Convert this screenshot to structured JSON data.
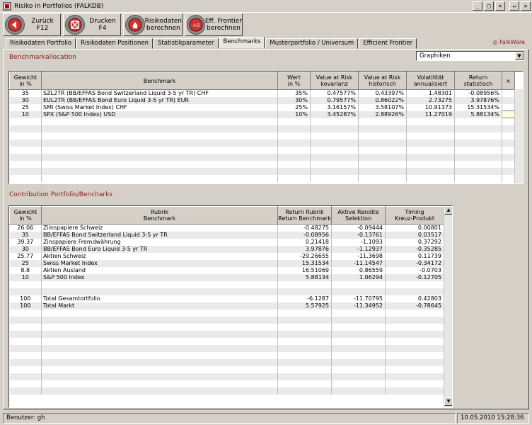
{
  "window": {
    "title": "Risiko in Portfolios   (FALKDB)",
    "controls": [
      "_",
      "□",
      "×",
      "↵",
      "✕"
    ]
  },
  "toolbar": [
    {
      "label": "Zurück\nF12",
      "icon": "back-arrow-icon"
    },
    {
      "label": "Drucken\nF4",
      "icon": "print-cancel-icon"
    },
    {
      "label": "Risikodaten\nberechnen",
      "icon": "calculate-risk-icon"
    },
    {
      "label": "Eff. Frontier\nberechnen",
      "icon": "frontier-calc-icon"
    }
  ],
  "tabs": [
    "Risikodaten Portfolio",
    "Risikodaten Positionen",
    "Statistikparameter",
    "Benchmarks",
    "Musterportfolio / Universum",
    "Efficient Frontier"
  ],
  "active_tab": "Benchmarks",
  "brand": "◎ FalkWare",
  "section1": {
    "title": "Benchmarkallocation",
    "dropdown_value": "Graphiken"
  },
  "table1": {
    "headers": [
      "Gewicht\nin %",
      "Benchmark",
      "Wert\nin %",
      "Value at Risk\nkovarianz",
      "Value at Risk\nhistorisch",
      "Volatilität\nannualisiert",
      "Return\nstatistisch",
      "×"
    ],
    "rows": [
      [
        "35",
        "SZL2TR  (BB/EFFAS Bond Switzerland Liquid 3-5 yr TR)  CHF",
        "35%",
        "0.47577%",
        "0.43397%",
        "1.48301",
        "-0.08956%"
      ],
      [
        "30",
        "EUL2TR  (BB/EFFAS Bond Euro Liquid 3-5 yr TR)  EUR",
        "30%",
        "0.79577%",
        "0.86022%",
        "2.73275",
        "3.97876%"
      ],
      [
        "25",
        "SMI  (Swiss Market Index)  CHF",
        "25%",
        "3.16157%",
        "3.58107%",
        "10.91373",
        "15.31534%"
      ],
      [
        "10",
        "SPX  (S&P 500 Index)  USD",
        "10%",
        "3.45287%",
        "2.88926%",
        "11.27019",
        "5.88134%"
      ]
    ]
  },
  "section2": {
    "title": "Contribution Portfolio/Bencharks"
  },
  "table2": {
    "headers": [
      "Gewicht\nin %",
      "Rubrik\nBenchmark",
      "Return Rubrik\nReturn Benchmark",
      "Aktive Rendite\nSelektion",
      "Timing\nKreuz-Produkt"
    ],
    "rows": [
      [
        "26.06",
        "Ziinspapiere Schweiz",
        "-0.48275",
        "-0.09444",
        "0.00801"
      ],
      [
        "35",
        "BB/EFFAS Bond Switzerland Liquid 3-5 yr TR",
        "-0.08956",
        "-0.13761",
        "0.03517"
      ],
      [
        "39.37",
        "Zinspapiere Fremdwährung",
        "0.21418",
        "-1.1093",
        "0.37292"
      ],
      [
        "30",
        "BB/EFFAS Bond Euro Liquid 3-5 yr TR",
        "3.97876",
        "-1.12937",
        "-0.35285"
      ],
      [
        "25.77",
        "Aktien Schweiz",
        "-29.26655",
        "-11.3698",
        "0.11739"
      ],
      [
        "25",
        "Swiss Market Index",
        "15.31534",
        "-11.14547",
        "-0.34172"
      ],
      [
        "8.8",
        "Aktien Ausland",
        "16.51069",
        "0.86559",
        "-0.0703"
      ],
      [
        "10",
        "S&P 500 Index",
        "5.88134",
        "1.06294",
        "-0.12705"
      ],
      [
        "",
        "",
        "",
        "",
        ""
      ],
      [
        "",
        "",
        "",
        "",
        ""
      ],
      [
        "100",
        "Total Gesamtortfolio",
        "-6.1287",
        "-11.70795",
        "0.42803"
      ],
      [
        "100",
        "Total Markt",
        "5.57925",
        "-11.34952",
        "-0.78645"
      ]
    ]
  },
  "status": {
    "user": "Benutzer: gh",
    "datetime": "10.05.2010 15:28:36"
  }
}
